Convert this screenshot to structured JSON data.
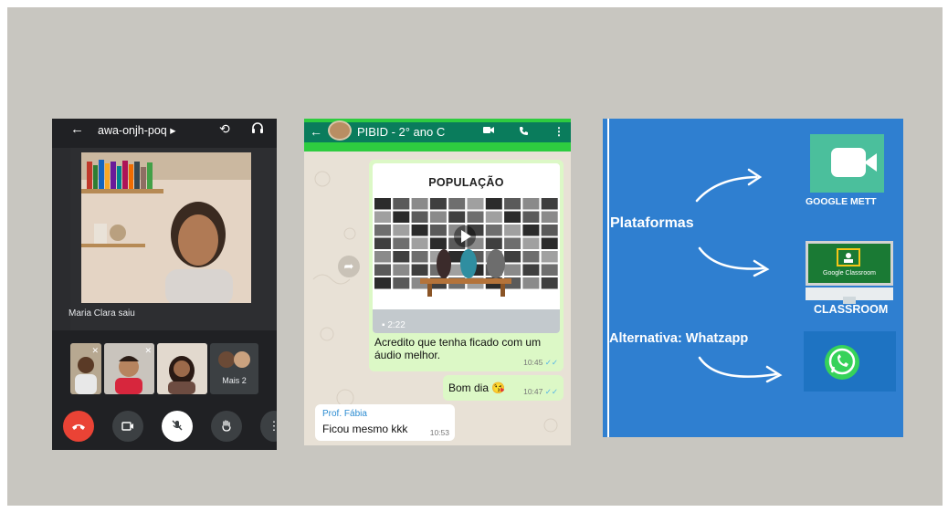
{
  "meet": {
    "meeting_code": "awa-onjh-poq",
    "code_caret": "▸",
    "left_caption": "Maria Clara saiu",
    "more_label": "Mais 2",
    "icons": {
      "back": "arrow-back-icon",
      "switch_camera": "switch-camera-icon",
      "audio": "headphones-icon",
      "end_call": "end-call-icon",
      "camera": "camera-icon",
      "mic_off": "mic-off-icon",
      "raise_hand": "hand-icon",
      "more": "more-vert-icon"
    }
  },
  "whatsapp": {
    "chat_title": "PIBID - 2° ano C",
    "media_title": "POPULAÇÃO",
    "media_duration": "2:22",
    "media_caption": "Acredito que tenha ficado com um áudio melhor.",
    "media_time": "10:45",
    "bom_dia_text": "Bom dia",
    "bom_dia_emoji": "😘",
    "bom_dia_time": "10:47",
    "incoming_sender": "Prof. Fábia",
    "incoming_text": "Ficou mesmo kkk",
    "incoming_time": "10:53",
    "colors": {
      "header": "#0a7c5c",
      "accent_bar": "#2ecc40",
      "outgoing": "#dcf8c6"
    }
  },
  "plataformas": {
    "heading": "Plataformas",
    "alternative": "Alternativa: Whatzapp",
    "google_meet_label": "GOOGLE METT",
    "classroom_label": "CLASSROOM",
    "classroom_screen_text": "Google Classroom",
    "colors": {
      "background": "#2f7fd0",
      "meet_icon": "#4bbf9c",
      "classroom_screen": "#1a7a34"
    }
  }
}
